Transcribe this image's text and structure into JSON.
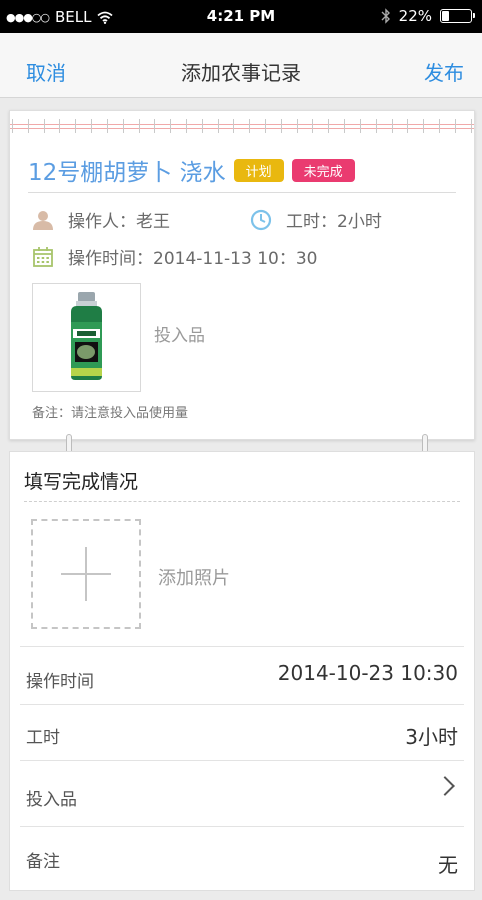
{
  "status_bar": {
    "carrier": "BELL",
    "time": "4:21 PM",
    "battery": "22%",
    "battery_level": 0.22
  },
  "nav": {
    "cancel": "取消",
    "title": "添加农事记录",
    "publish": "发布"
  },
  "plan": {
    "title": "12号棚胡萝卜 浇水",
    "badges": {
      "plan": "计划",
      "status": "未完成"
    },
    "operator": "操作人：老王",
    "duration": "工时：2小时",
    "op_time": "操作时间：2014-11-13  10：30",
    "product_label": "投入品",
    "remark": "备注：请注意投入品使用量",
    "product_icon": "pesticide-bottle-image"
  },
  "complete": {
    "title": "填写完成情况",
    "add_photo": "添加照片",
    "rows": [
      {
        "label": "操作时间",
        "value": "2014-10-23 10:30"
      },
      {
        "label": "工时",
        "value": "3小时"
      },
      {
        "label": "投入品",
        "value": ""
      },
      {
        "label": "备注",
        "value": "无"
      }
    ]
  },
  "colors": {
    "accent": "#2e8de0",
    "title_blue": "#5b9de2",
    "plan_badge": "#e9b80f",
    "status_badge": "#ea3b70"
  }
}
